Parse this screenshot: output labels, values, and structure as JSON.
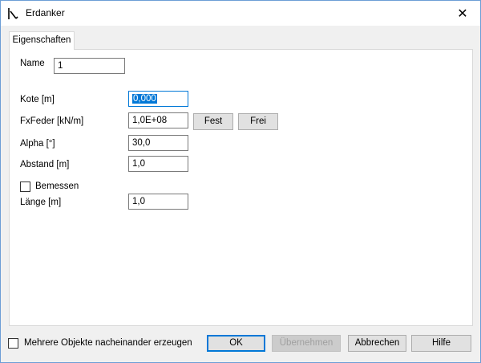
{
  "window": {
    "title": "Erdanker",
    "close_glyph": "✕"
  },
  "tabs": [
    {
      "label": "Eigenschaften"
    }
  ],
  "form": {
    "name_label": "Name",
    "name_value": "1",
    "kote_label": "Kote [m]",
    "kote_value": "0,000",
    "fxfeder_label": "FxFeder [kN/m]",
    "fxfeder_value": "1,0E+08",
    "fest_label": "Fest",
    "frei_label": "Frei",
    "alpha_label": "Alpha [°]",
    "alpha_value": "30,0",
    "abstand_label": "Abstand [m]",
    "abstand_value": "1,0",
    "bemessen_label": "Bemessen",
    "bemessen_checked": false,
    "laenge_label": "Länge [m]",
    "laenge_value": "1,0"
  },
  "footer": {
    "multi_label": "Mehrere Objekte nacheinander erzeugen",
    "multi_checked": false,
    "ok_label": "OK",
    "apply_label": "Übernehmen",
    "cancel_label": "Abbrechen",
    "help_label": "Hilfe"
  },
  "colors": {
    "accent": "#0078d7",
    "border": "#6d9ed6"
  }
}
